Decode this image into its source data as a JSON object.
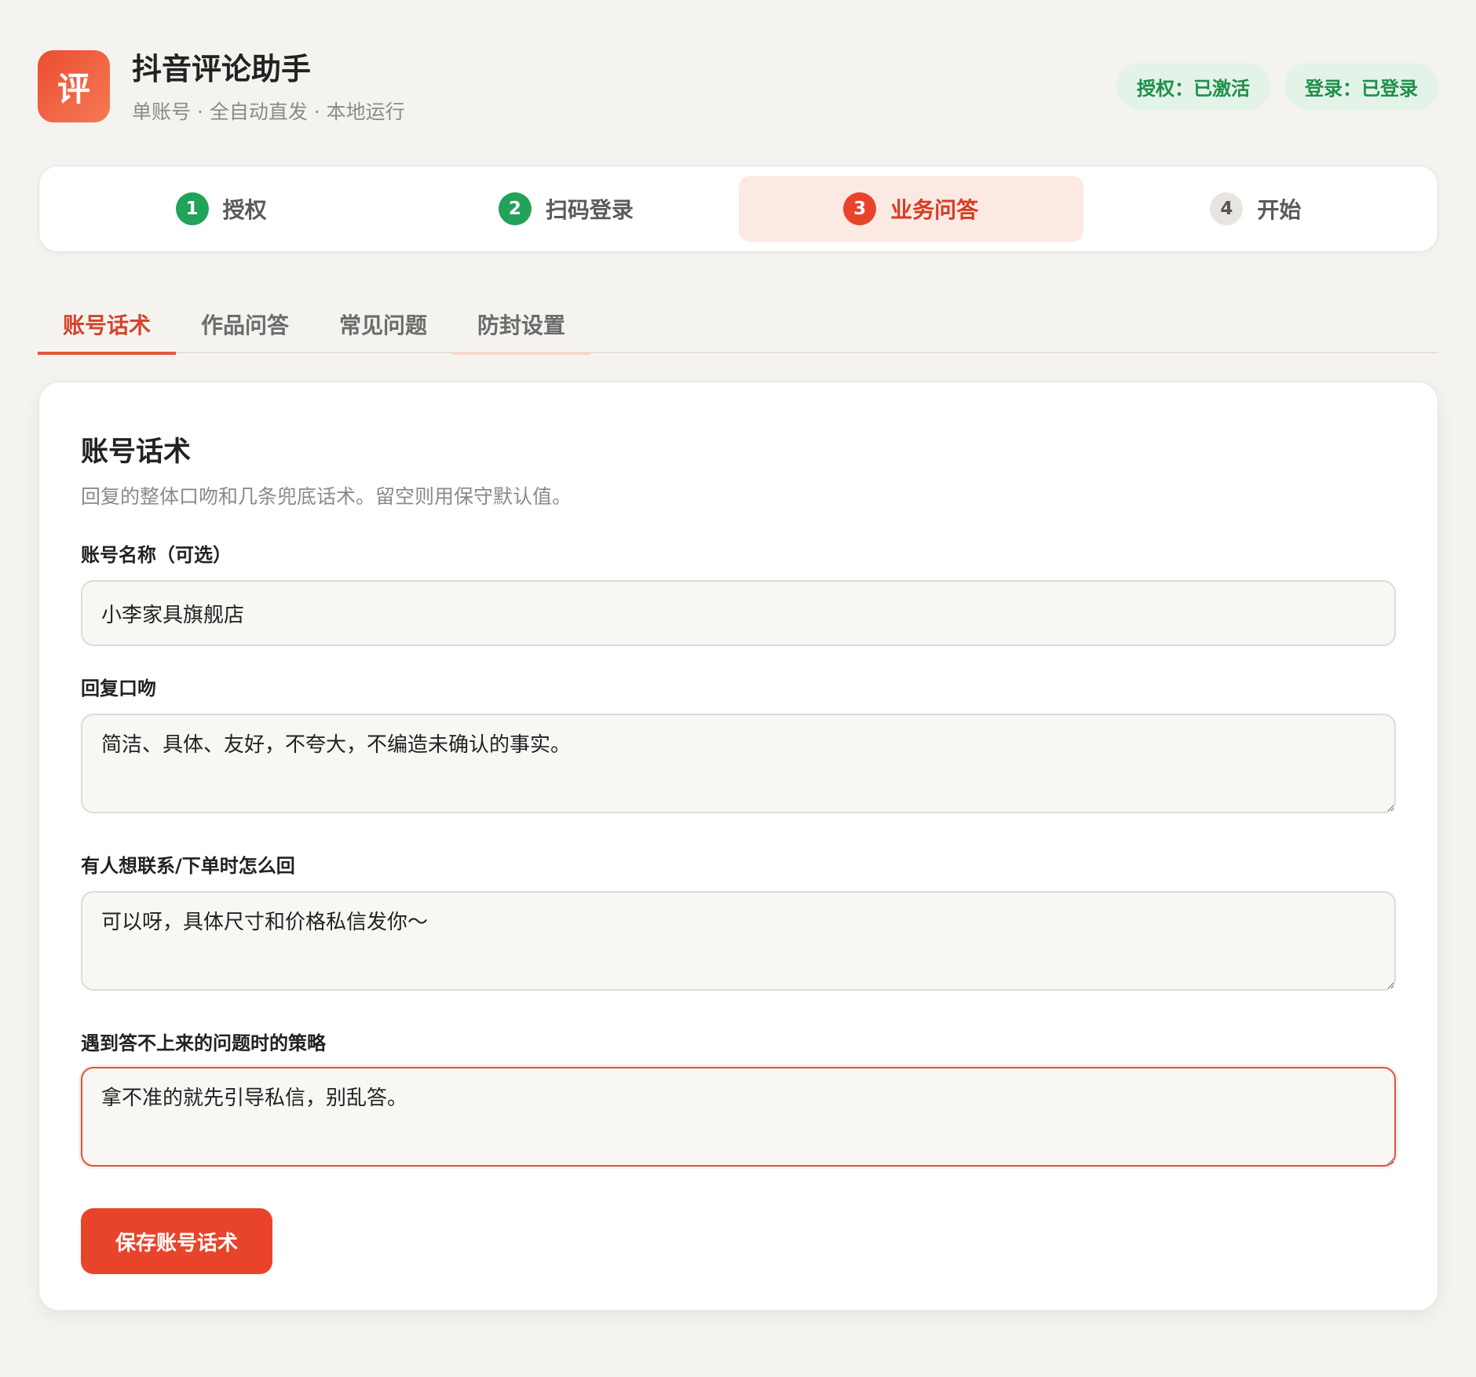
{
  "app": {
    "logo_char": "评",
    "title": "抖音评论助手",
    "subtitle": "单账号 · 全自动直发 · 本地运行",
    "accent_color": "#e8442c"
  },
  "status": {
    "license": "授权：已激活",
    "login": "登录：已登录"
  },
  "steps": [
    {
      "num": "1",
      "label": "授权",
      "state": "done"
    },
    {
      "num": "2",
      "label": "扫码登录",
      "state": "done"
    },
    {
      "num": "3",
      "label": "业务问答",
      "state": "current"
    },
    {
      "num": "4",
      "label": "开始",
      "state": "todo"
    }
  ],
  "tabs": [
    {
      "label": "账号话术",
      "active": true
    },
    {
      "label": "作品问答",
      "active": false
    },
    {
      "label": "常见问题",
      "active": false
    },
    {
      "label": "防封设置",
      "active": false
    }
  ],
  "form": {
    "title": "账号话术",
    "description": "回复的整体口吻和几条兜底话术。留空则用保守默认值。",
    "account_name_label": "账号名称（可选）",
    "account_name_value": "小李家具旗舰店",
    "tone_label": "回复口吻",
    "tone_value": "简洁、具体、友好，不夸大，不编造未确认的事实。",
    "contact_label": "有人想联系/下单时怎么回",
    "contact_value": "可以呀，具体尺寸和价格私信发你～",
    "fallback_label": "遇到答不上来的问题时的策略",
    "fallback_value": "拿不准的就先引导私信，别乱答。",
    "save_label": "保存账号话术"
  }
}
